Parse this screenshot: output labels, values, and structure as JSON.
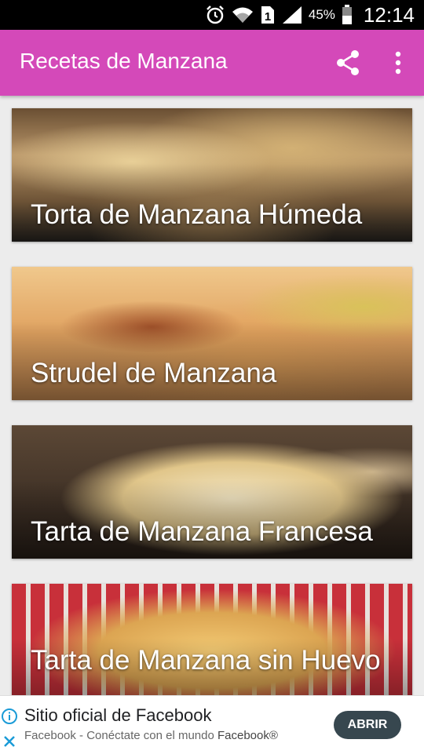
{
  "status_bar": {
    "battery": "45%",
    "time": "12:14",
    "sim": "1",
    "icons": [
      "alarm-icon",
      "wifi-icon",
      "sim-icon",
      "signal-icon",
      "battery-icon"
    ]
  },
  "app_bar": {
    "title": "Recetas de Manzana",
    "color": "#d449b9",
    "actions": [
      "share-icon",
      "more-vert-icon"
    ]
  },
  "recipes": [
    {
      "title": "Torta de Manzana Húmeda"
    },
    {
      "title": "Strudel de Manzana"
    },
    {
      "title": "Tarta de Manzana Francesa"
    },
    {
      "title": "Tarta de Manzana sin Huevo"
    }
  ],
  "ad": {
    "title": "Sitio oficial de Facebook",
    "subtitle": "Facebook - Conéctate con el mundo",
    "brand": "Facebook®",
    "button": "ABRIR",
    "icons": [
      "adchoices-info-icon",
      "ad-close-icon"
    ]
  }
}
